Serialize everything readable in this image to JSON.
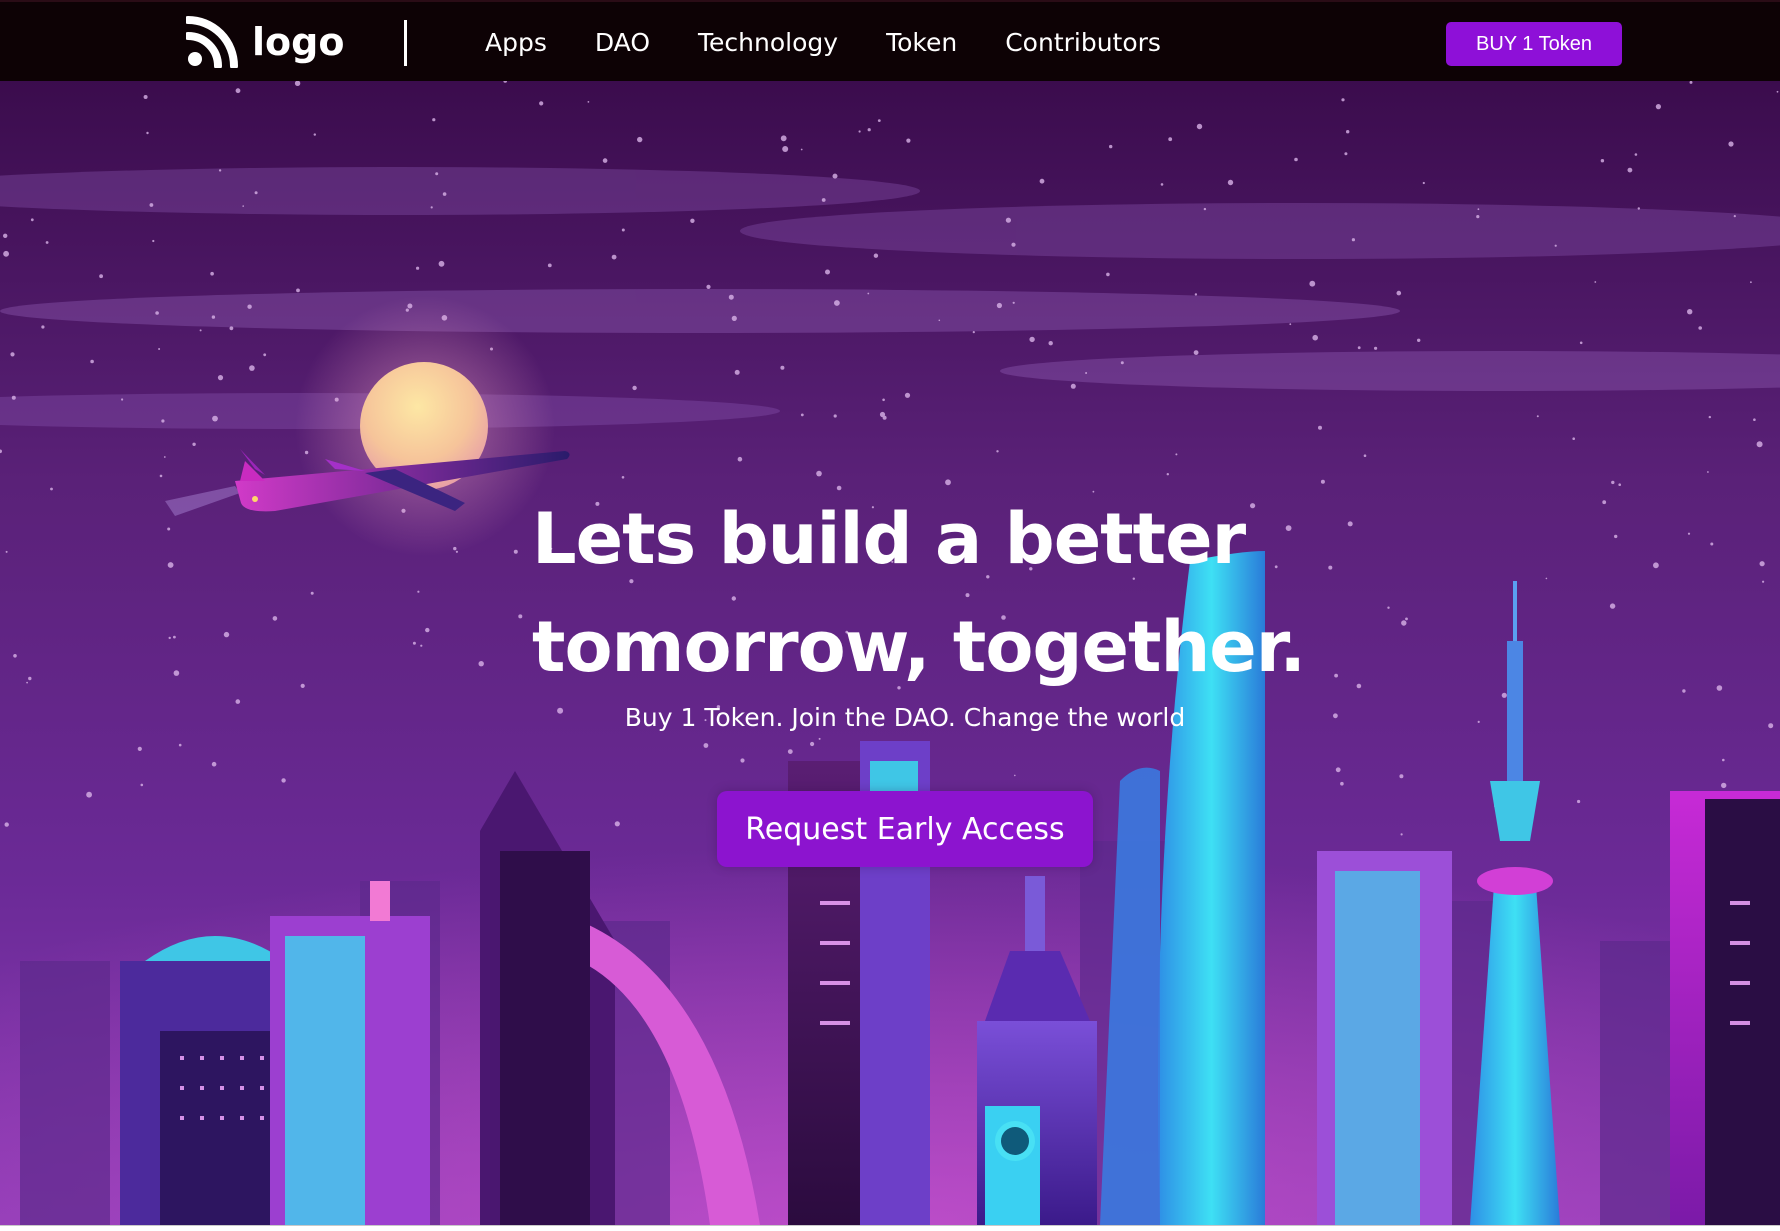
{
  "brand": {
    "logo_text": "logo",
    "logo_icon": "rss-feed-icon"
  },
  "nav": {
    "links": [
      "Apps",
      "DAO",
      "Technology",
      "Token",
      "Contributors"
    ],
    "buy_label": "BUY 1 Token"
  },
  "hero": {
    "title_line1": "Lets build a better",
    "title_line2": "tomorrow, together.",
    "subtitle": "Buy 1 Token. Join the DAO. Change the world",
    "cta_label": "Request Early Access"
  },
  "colors": {
    "nav_background": "#0d0205",
    "accent_purple": "#8e10d8",
    "sky_top": "#3a0d4e",
    "sky_bottom": "#7a2fa8",
    "neon_cyan": "#3ad9f2",
    "neon_magenta": "#e43fd8"
  }
}
